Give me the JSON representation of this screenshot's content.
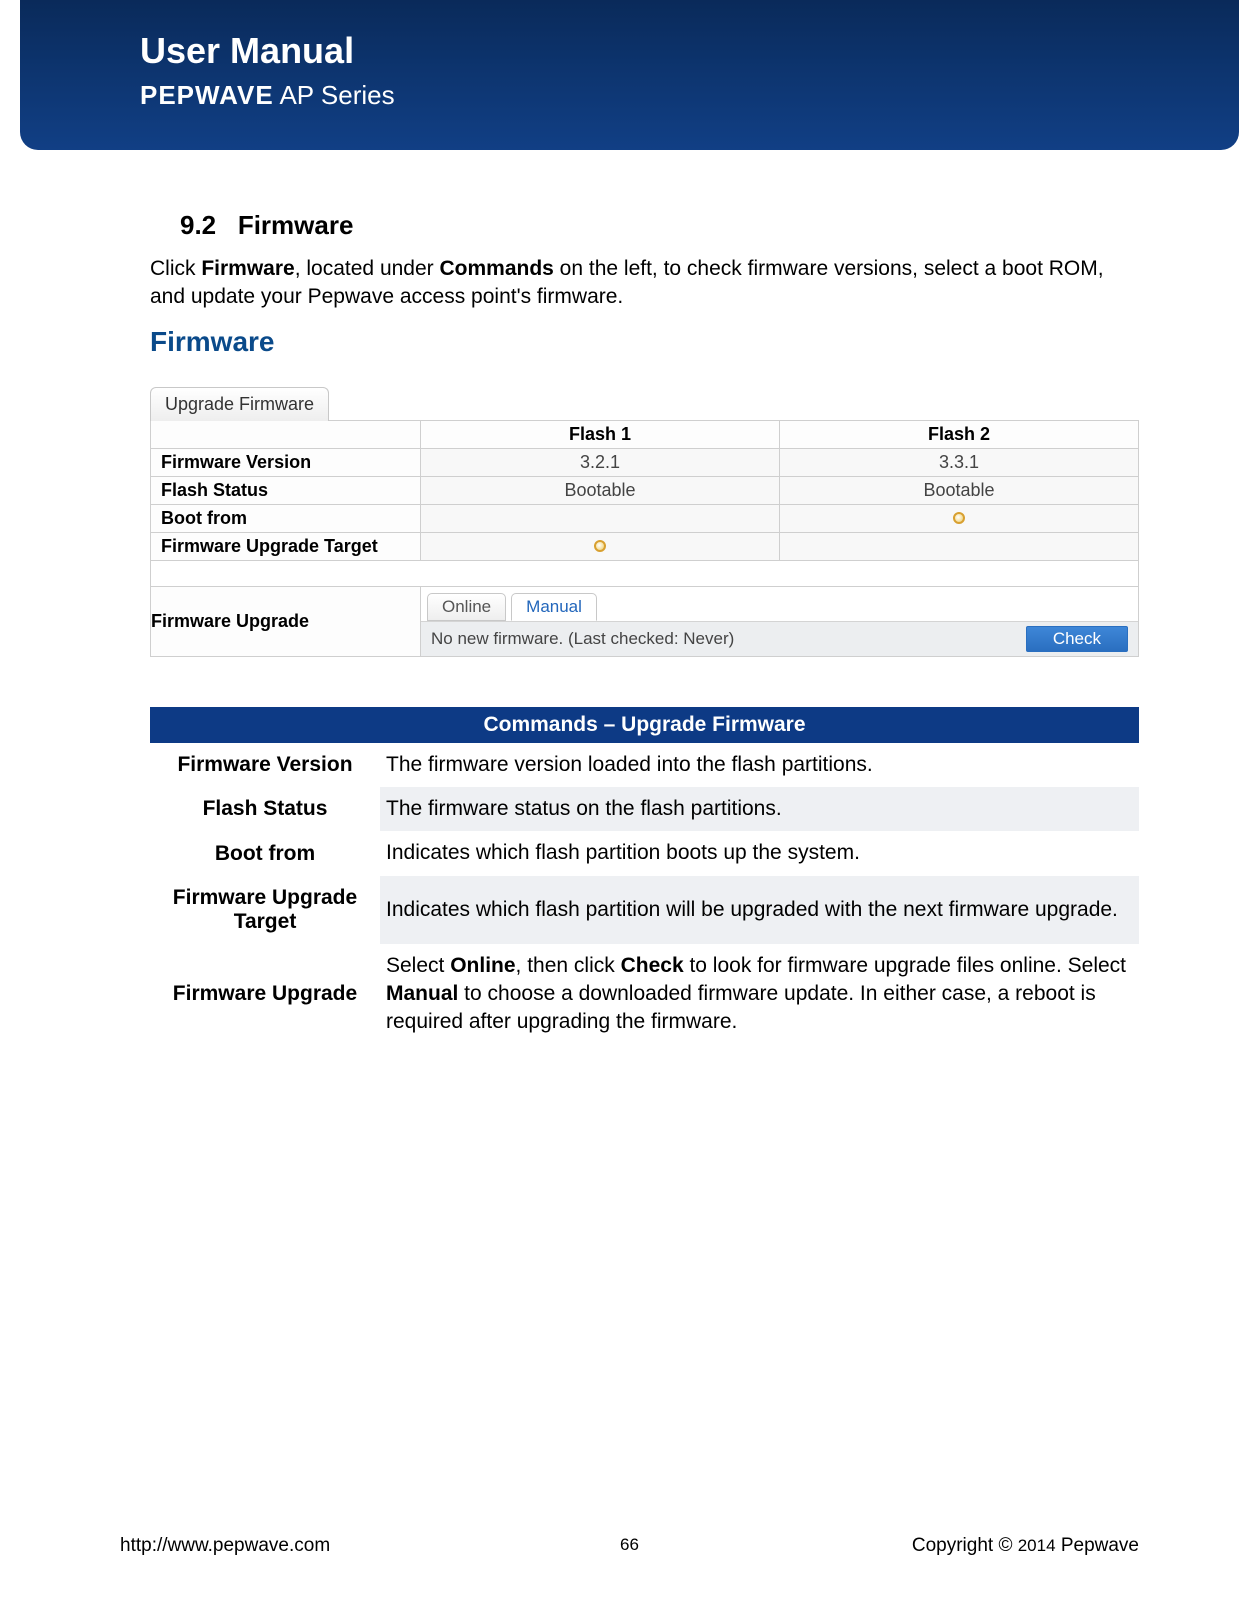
{
  "header": {
    "title": "User Manual",
    "brand_bold": "PEPWAVE",
    "brand_light": " AP Series"
  },
  "section": {
    "number": "9.2",
    "title": "Firmware",
    "intro_pre": "Click ",
    "intro_b1": "Firmware",
    "intro_mid1": ", located under ",
    "intro_b2": "Commands",
    "intro_post": " on the left, to check firmware versions, select a boot ROM, and update your Pepwave access point's firmware."
  },
  "screenshot": {
    "heading": "Firmware",
    "tab": "Upgrade Firmware",
    "cols": {
      "empty": "",
      "flash1": "Flash 1",
      "flash2": "Flash 2"
    },
    "rows": {
      "fw_version": {
        "label": "Firmware Version",
        "v1": "3.2.1",
        "v2": "3.3.1"
      },
      "flash_status": {
        "label": "Flash Status",
        "v1": "Bootable",
        "v2": "Bootable"
      },
      "boot_from": {
        "label": "Boot from"
      },
      "upgrade_target": {
        "label": "Firmware Upgrade Target"
      },
      "upgrade": {
        "label": "Firmware Upgrade"
      }
    },
    "sub_tabs": {
      "online": "Online",
      "manual": "Manual"
    },
    "status_text": "No new firmware. (Last checked: Never)",
    "check_button": "Check"
  },
  "desc": {
    "header": "Commands – Upgrade Firmware",
    "rows": [
      {
        "label": "Firmware Version",
        "text": "The firmware version loaded into the flash partitions.",
        "shade": false
      },
      {
        "label": "Flash Status",
        "text": "The firmware status on the flash partitions.",
        "shade": true
      },
      {
        "label": "Boot from",
        "text": "Indicates which flash partition boots up the system.",
        "shade": false
      },
      {
        "label": "Firmware Upgrade Target",
        "text": "Indicates which flash partition will be upgraded with the next firmware upgrade.",
        "shade": true
      }
    ],
    "upgrade_row": {
      "label": "Firmware Upgrade",
      "p1": "Select ",
      "b1": "Online",
      "p2": ", then click ",
      "b2": "Check",
      "p3": " to look for firmware upgrade files online. Select ",
      "b3": "Manual",
      "p4": " to choose a downloaded firmware update. In either case, a reboot is required after upgrading the firmware."
    }
  },
  "footer": {
    "url": "http://www.pepwave.com",
    "page": "66",
    "copyright_pre": "Copyright  ©  ",
    "copyright_year": "2014",
    "copyright_post": "  Pepwave"
  }
}
